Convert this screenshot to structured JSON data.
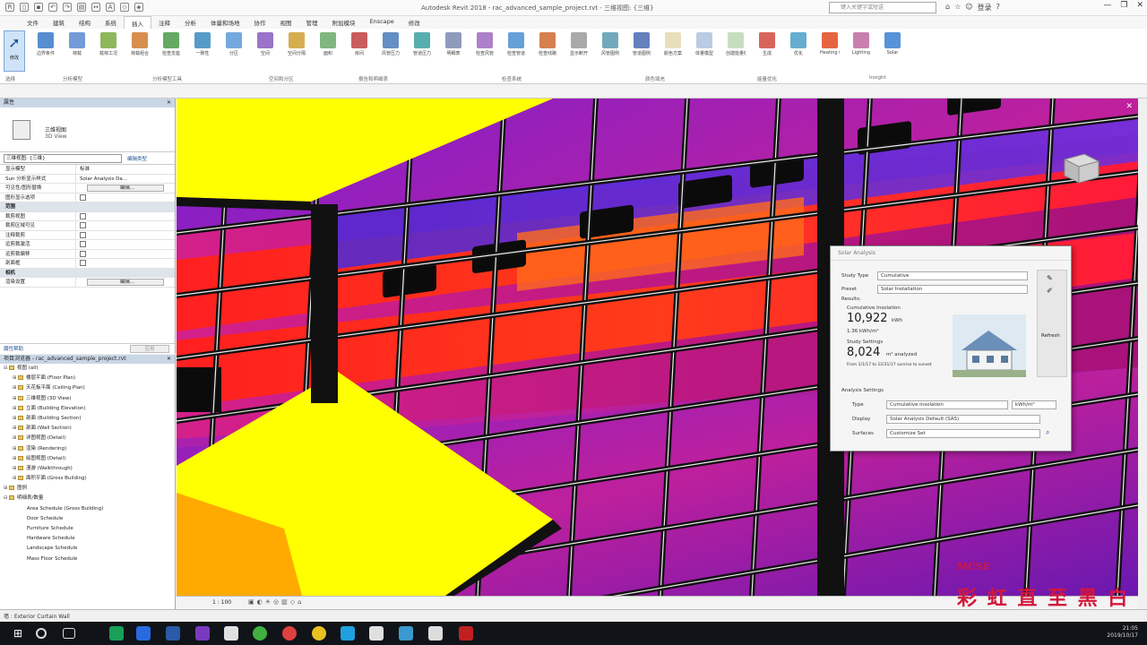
{
  "app": {
    "title": "Autodesk Revit 2018 - rac_advanced_sample_project.rvt - 三维视图: {三维}",
    "search_placeholder": "键入关键字或短语",
    "user": "登录",
    "window_controls": [
      "—",
      "❐",
      "✕"
    ]
  },
  "ribbon_tabs": [
    "文件",
    "建筑",
    "结构",
    "系统",
    "插入",
    "注释",
    "分析",
    "体量和场地",
    "协作",
    "视图",
    "管理",
    "附加模块",
    "Enscape",
    "修改"
  ],
  "ribbon": {
    "modify_label": "修改",
    "panels": [
      "选择",
      "分析模型",
      "分析模型工具",
      "空间和分区",
      "报告和明细表",
      "检查系统",
      "颜色填充",
      "能量优化",
      "Insight"
    ],
    "buttons": [
      "边界条件",
      "荷载",
      "载荷工况",
      "荷载组合",
      "检查支座",
      "一致性",
      "分区",
      "空间",
      "空间分隔",
      "面积",
      "房间",
      "风管压力",
      "管道压力",
      "明细表",
      "检查风管",
      "检查管道",
      "检查线路",
      "显示断开",
      "风管图例",
      "管道图例",
      "颜色方案",
      "体量模型",
      "创建能量模型",
      "生成",
      "优化",
      "Heating Cooling",
      "Lighting",
      "Solar"
    ]
  },
  "properties": {
    "title": "属性",
    "type_name": "三维视图",
    "type_sub": "3D View",
    "instance_selector": "三维视图: {三维}",
    "edit_type": "编辑类型",
    "rows": [
      {
        "k": "显示模型",
        "v": "标准",
        "kind": "text"
      },
      {
        "k": "Sun 分析显示样式",
        "v": "Solar Analysis Da...",
        "kind": "text"
      },
      {
        "k": "可见性/图形替换",
        "v": "编辑...",
        "kind": "button"
      },
      {
        "k": "图形显示选项",
        "v": "",
        "kind": "check"
      },
      {
        "k": "范围",
        "v": "",
        "kind": "group"
      },
      {
        "k": "裁剪视图",
        "v": "",
        "kind": "check"
      },
      {
        "k": "裁剪区域可见",
        "v": "",
        "kind": "check"
      },
      {
        "k": "注释裁剪",
        "v": "",
        "kind": "check"
      },
      {
        "k": "远剪裁激活",
        "v": "",
        "kind": "check"
      },
      {
        "k": "远剪裁偏移",
        "v": "",
        "kind": "check"
      },
      {
        "k": "剖面框",
        "v": "",
        "kind": "check"
      },
      {
        "k": "相机",
        "v": "",
        "kind": "group"
      },
      {
        "k": "渲染设置",
        "v": "编辑...",
        "kind": "button"
      }
    ],
    "help": "属性帮助",
    "apply": "应用"
  },
  "browser": {
    "title": "项目浏览器 - rac_advanced_sample_project.rvt",
    "items": [
      {
        "t": "视图 (all)",
        "lvl": 0,
        "tg": "⊟"
      },
      {
        "t": "楼层平面 (Floor Plan)",
        "lvl": 1,
        "tg": "⊞"
      },
      {
        "t": "天花板平面 (Ceiling Plan)",
        "lvl": 1,
        "tg": "⊞"
      },
      {
        "t": "三维视图 (3D View)",
        "lvl": 1,
        "tg": "⊞"
      },
      {
        "t": "立面 (Building Elevation)",
        "lvl": 1,
        "tg": "⊞"
      },
      {
        "t": "剖面 (Building Section)",
        "lvl": 1,
        "tg": "⊞"
      },
      {
        "t": "剖面 (Wall Section)",
        "lvl": 1,
        "tg": "⊞"
      },
      {
        "t": "详图视图 (Detail)",
        "lvl": 1,
        "tg": "⊞"
      },
      {
        "t": "渲染 (Rendering)",
        "lvl": 1,
        "tg": "⊞"
      },
      {
        "t": "绘图视图 (Detail)",
        "lvl": 1,
        "tg": "⊞"
      },
      {
        "t": "漫游 (Walkthrough)",
        "lvl": 1,
        "tg": "⊞"
      },
      {
        "t": "面积平面 (Gross Building)",
        "lvl": 1,
        "tg": "⊞"
      },
      {
        "t": "图例",
        "lvl": 0,
        "tg": "⊞"
      },
      {
        "t": "明细表/数量",
        "lvl": 0,
        "tg": "⊟"
      },
      {
        "t": "Area Schedule (Gross Building)",
        "lvl": 2,
        "tg": ""
      },
      {
        "t": "Door Schedule",
        "lvl": 2,
        "tg": ""
      },
      {
        "t": "Furniture Schedule",
        "lvl": 2,
        "tg": ""
      },
      {
        "t": "Hardware Schedule",
        "lvl": 2,
        "tg": ""
      },
      {
        "t": "Landscape Schedule",
        "lvl": 2,
        "tg": ""
      },
      {
        "t": "Mass Floor Schedule",
        "lvl": 2,
        "tg": ""
      }
    ]
  },
  "dialog": {
    "title": "Solar Analysis",
    "study_type_label": "Study Type",
    "study_type": "Cumulative",
    "preset_label": "Preset",
    "preset": "Solar Installation",
    "results_label": "Results:",
    "insolation_label": "Cumulative Insolation",
    "insolation_value": "10,922",
    "insolation_unit": "kWh",
    "insolation_sub": "1.36 kWh/m²",
    "savings_label": "Study Settings",
    "area_value": "8,024",
    "area_unit": "m² analyzed",
    "area_sub": "From 1/1/17 to 12/31/17 sunrise to sunset",
    "refresh": "Refresh",
    "settings_header": "Analysis Settings",
    "type_label": "Type",
    "type_value": "Cumulative Insolation",
    "unit_value": "kWh/m²",
    "display_label": "Display",
    "display_value": "Solar Analysis Default (SAS)",
    "surfaces_label": "Surfaces",
    "surfaces_value": "Customize Set"
  },
  "view": {
    "scale": "1 : 100"
  },
  "status": {
    "text": "墙 : Exterior Curtain Wall"
  },
  "clock": {
    "time": "21:05",
    "date": "2019/10/17"
  },
  "watermark": {
    "top": "MCSE",
    "text": "彩 虹 直 至 黑 白"
  },
  "colors": {
    "accent": "#1a4f94",
    "selected": "#cfe3f8",
    "heat_red": "#ff1a1a",
    "heat_purple": "#8b1fb8",
    "heat_yellow": "#ffff00"
  }
}
